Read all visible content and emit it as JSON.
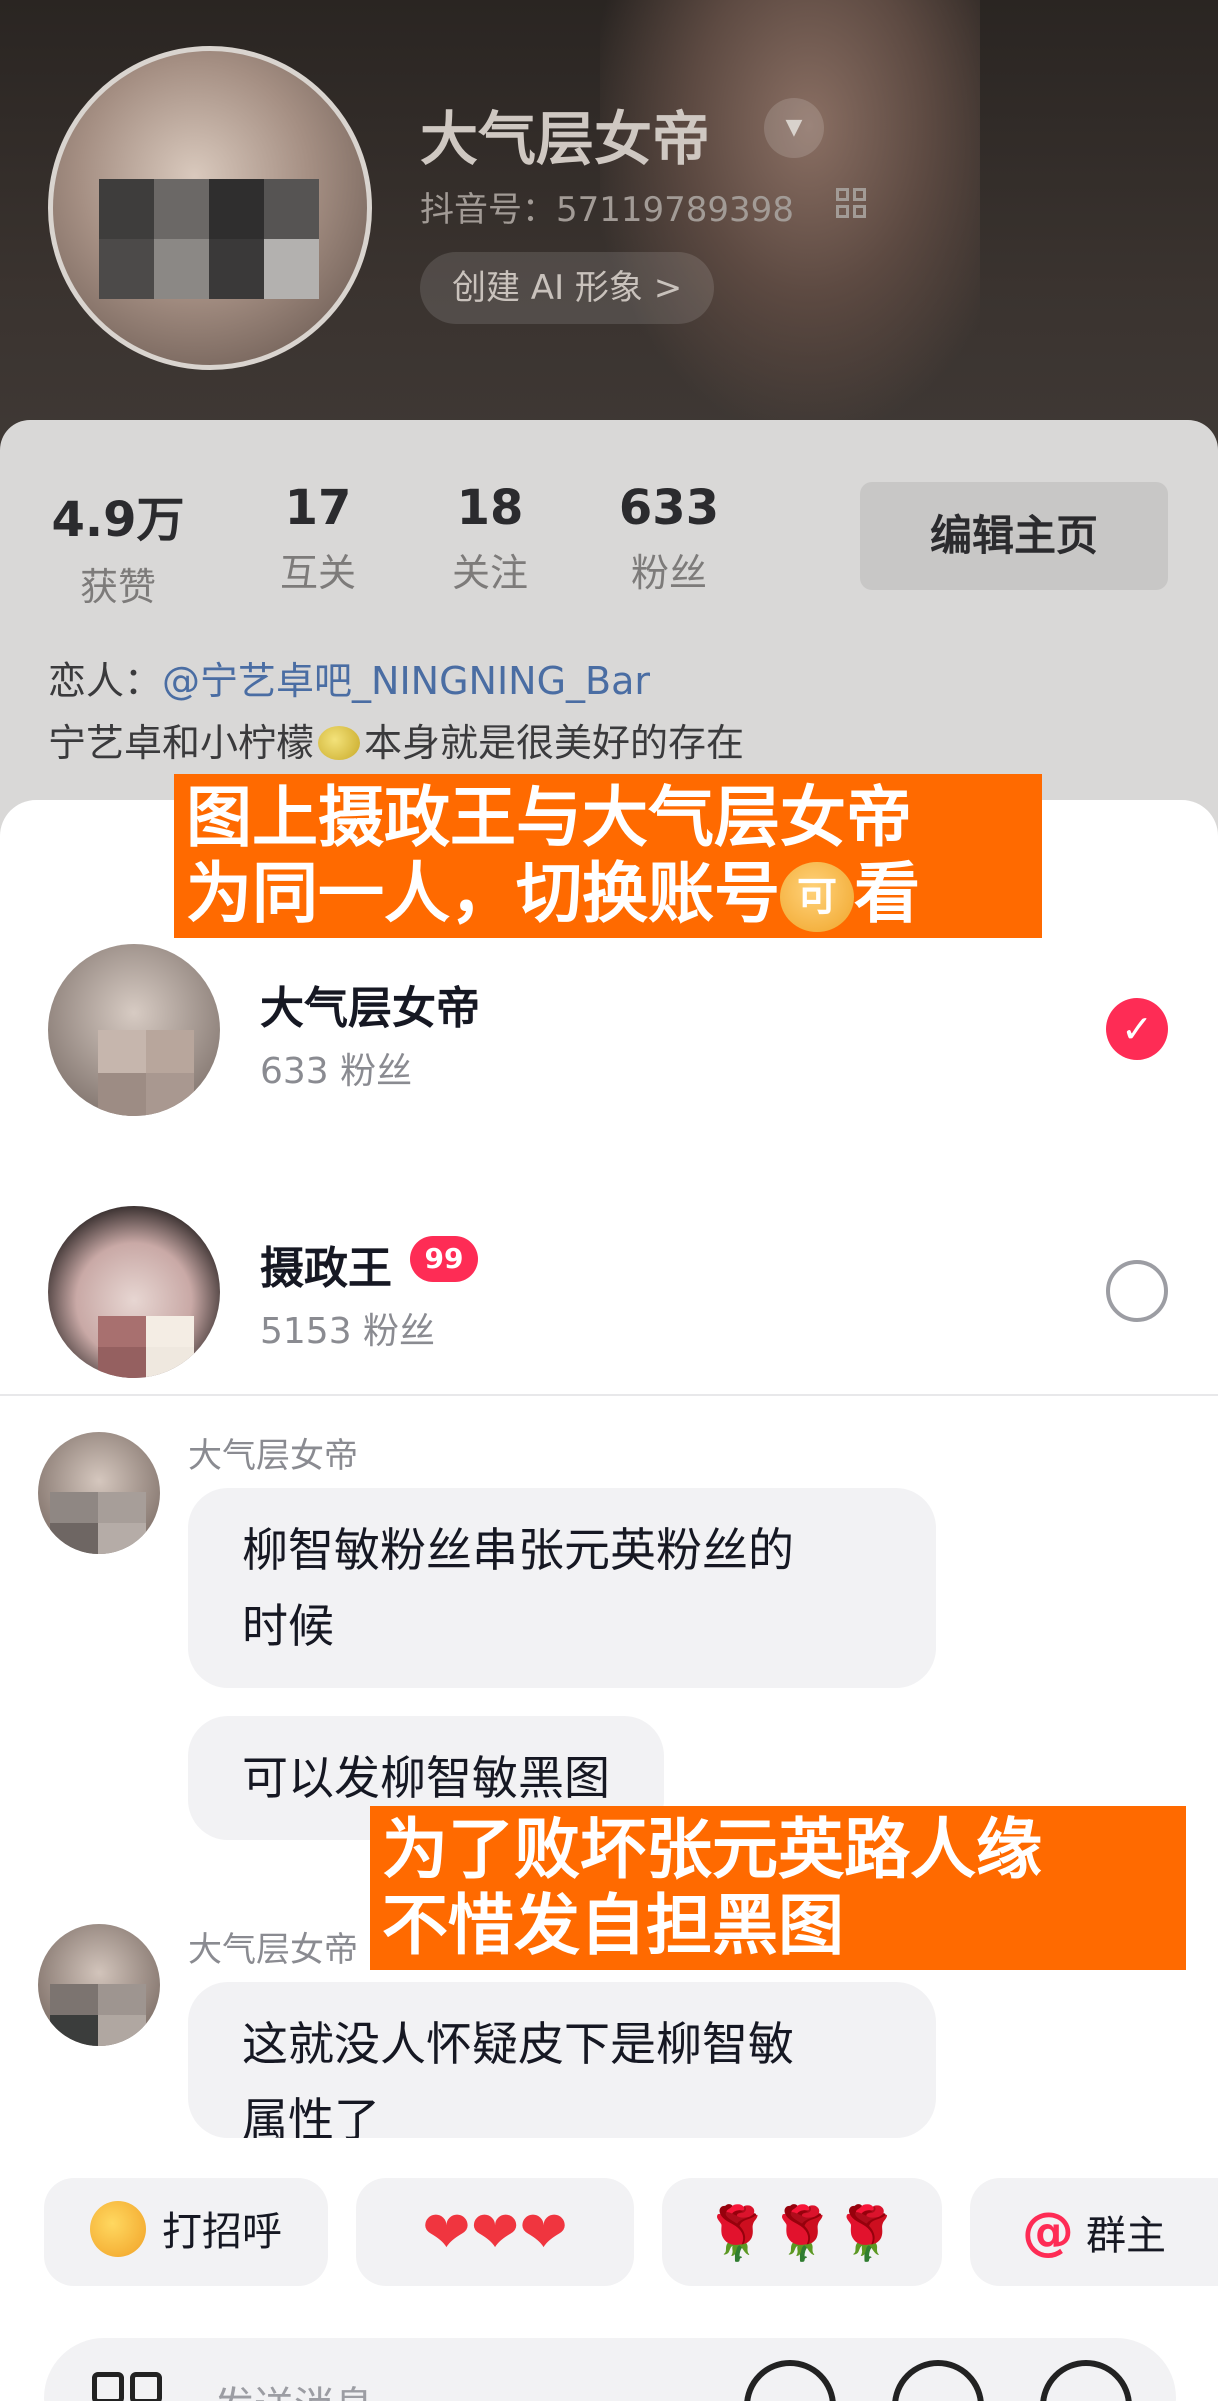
{
  "profile": {
    "name": "大气层女帝",
    "douyin_id": "抖音号：57119789398",
    "create_ai_label": "创建 AI 形象 >",
    "stats": [
      {
        "value": "4.9万",
        "label": "获赞"
      },
      {
        "value": "17",
        "label": "互关"
      },
      {
        "value": "18",
        "label": "关注"
      },
      {
        "value": "633",
        "label": "粉丝"
      }
    ],
    "edit_label": "编辑主页",
    "lover_prefix": "恋人：",
    "lover_link": "@宁艺卓吧_NINGNING_Bar",
    "bio_before": "宁艺卓和小柠檬",
    "bio_after": "本身就是很美好的存在"
  },
  "accounts": [
    {
      "name": "大气层女帝",
      "fans": "633 粉丝",
      "selected": true
    },
    {
      "name": "摄政王",
      "fans": "5153 粉丝",
      "badge": "99",
      "selected": false
    }
  ],
  "captions": {
    "top_line1": "图上摄政王与大气层女帝",
    "top_line2_before": "为同一人，切换账号",
    "top_line2_emoji": "可",
    "top_line2_after": "看",
    "bottom_line1": "为了败坏张元英路人缘",
    "bottom_line2": "不惜发自担黑图"
  },
  "chat": {
    "messages": [
      {
        "sender": "大气层女帝",
        "bubbles": [
          "柳智敏粉丝串张元英粉丝的",
          "时候"
        ]
      },
      {
        "bubble": "可以发柳智敏黑图"
      },
      {
        "sender": "大气层女帝",
        "bubbles": [
          "这就没人怀疑皮下是柳智敏",
          "属性了"
        ]
      }
    ]
  },
  "quick_replies": [
    {
      "label": "打招呼",
      "icon": "smile-face-icon"
    },
    {
      "label": "❤❤❤",
      "icon": "hearts-icon"
    },
    {
      "label": "🌹🌹🌹",
      "icon": "roses-icon"
    },
    {
      "label": "群主",
      "prefix": "@"
    }
  ],
  "message_input": {
    "placeholder": "发送消息"
  },
  "colors": {
    "accent": "#fe2c55",
    "caption_bg": "#ff6a00",
    "link": "#4a6da3"
  }
}
